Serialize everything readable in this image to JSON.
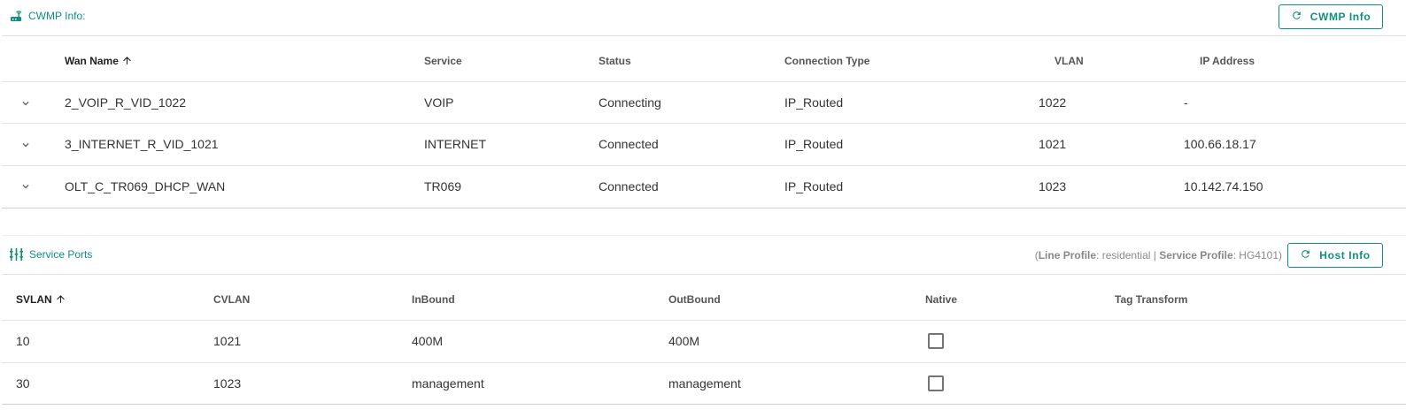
{
  "cwmp": {
    "title": "CWMP Info:",
    "button_label": "CWMP Info",
    "columns": [
      "Wan Name",
      "Service",
      "Status",
      "Connection Type",
      "VLAN",
      "IP Address"
    ],
    "rows": [
      {
        "wan_name": "2_VOIP_R_VID_1022",
        "service": "VOIP",
        "status": "Connecting",
        "connection_type": "IP_Routed",
        "vlan": "1022",
        "ip": "-"
      },
      {
        "wan_name": "3_INTERNET_R_VID_1021",
        "service": "INTERNET",
        "status": "Connected",
        "connection_type": "IP_Routed",
        "vlan": "1021",
        "ip": "100.66.18.17"
      },
      {
        "wan_name": "OLT_C_TR069_DHCP_WAN",
        "service": "TR069",
        "status": "Connected",
        "connection_type": "IP_Routed",
        "vlan": "1023",
        "ip": "10.142.74.150"
      }
    ]
  },
  "service_ports": {
    "title": "Service Ports",
    "button_label": "Host Info",
    "profile": {
      "line_label": "Line Profile",
      "line_value": "residential",
      "service_label": "Service Profile",
      "service_value": "HG4101"
    },
    "columns": [
      "SVLAN",
      "CVLAN",
      "InBound",
      "OutBound",
      "Native",
      "Tag Transform"
    ],
    "rows": [
      {
        "svlan": "10",
        "cvlan": "1021",
        "inbound": "400M",
        "outbound": "400M",
        "native": false,
        "tag_transform": ""
      },
      {
        "svlan": "30",
        "cvlan": "1023",
        "inbound": "management",
        "outbound": "management",
        "native": false,
        "tag_transform": ""
      }
    ]
  },
  "icons": {
    "cwmp_title": "router-icon",
    "ports_title": "ports-icon",
    "refresh": "refresh-icon",
    "sort": "arrow-up-icon",
    "expand": "chevron-down-icon"
  },
  "colors": {
    "accent": "#0f8f7f"
  }
}
